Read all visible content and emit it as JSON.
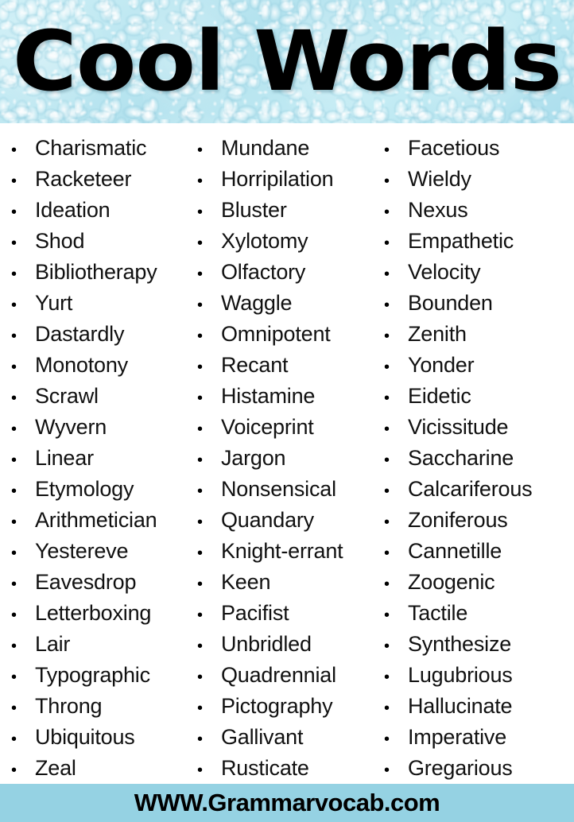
{
  "header": {
    "title": "Cool Words",
    "background_color": "#bfe8f1",
    "title_color": "#000000",
    "texture": "water-droplets"
  },
  "list": {
    "bullet_glyph": "•",
    "text_color": "#111111",
    "columns": [
      {
        "id": "column-1",
        "words": [
          "Charismatic",
          "Racketeer",
          "Ideation",
          "Shod",
          "Bibliotherapy",
          "Yurt",
          "Dastardly",
          "Monotony",
          "Scrawl",
          "Wyvern",
          "Linear",
          "Etymology",
          "Arithmetician",
          "Yestereve",
          "Eavesdrop",
          "Letterboxing",
          "Lair",
          "Typographic",
          "Throng",
          "Ubiquitous",
          "Zeal"
        ]
      },
      {
        "id": "column-2",
        "words": [
          "Mundane",
          "Horripilation",
          "Bluster",
          "Xylotomy",
          "Olfactory",
          "Waggle",
          "Omnipotent",
          "Recant",
          "Histamine",
          "Voiceprint",
          "Jargon",
          "Nonsensical",
          "Quandary",
          "Knight-errant",
          "Keen",
          "Pacifist",
          "Unbridled",
          "Quadrennial",
          "Pictography",
          "Gallivant",
          "Rusticate"
        ]
      },
      {
        "id": "column-3",
        "words": [
          "Facetious",
          "Wieldy",
          "Nexus",
          "Empathetic",
          "Velocity",
          "Bounden",
          "Zenith",
          "Yonder",
          "Eidetic",
          "Vicissitude",
          "Saccharine",
          "Calcariferous",
          "Zoniferous",
          "Cannetille",
          "Zoogenic",
          "Tactile",
          "Synthesize",
          "Lugubrious",
          "Hallucinate",
          "Imperative",
          "Gregarious"
        ]
      }
    ]
  },
  "footer": {
    "website": "WWW.Grammarvocab.com",
    "background_color": "#95d2e3",
    "text_color": "#000000"
  }
}
